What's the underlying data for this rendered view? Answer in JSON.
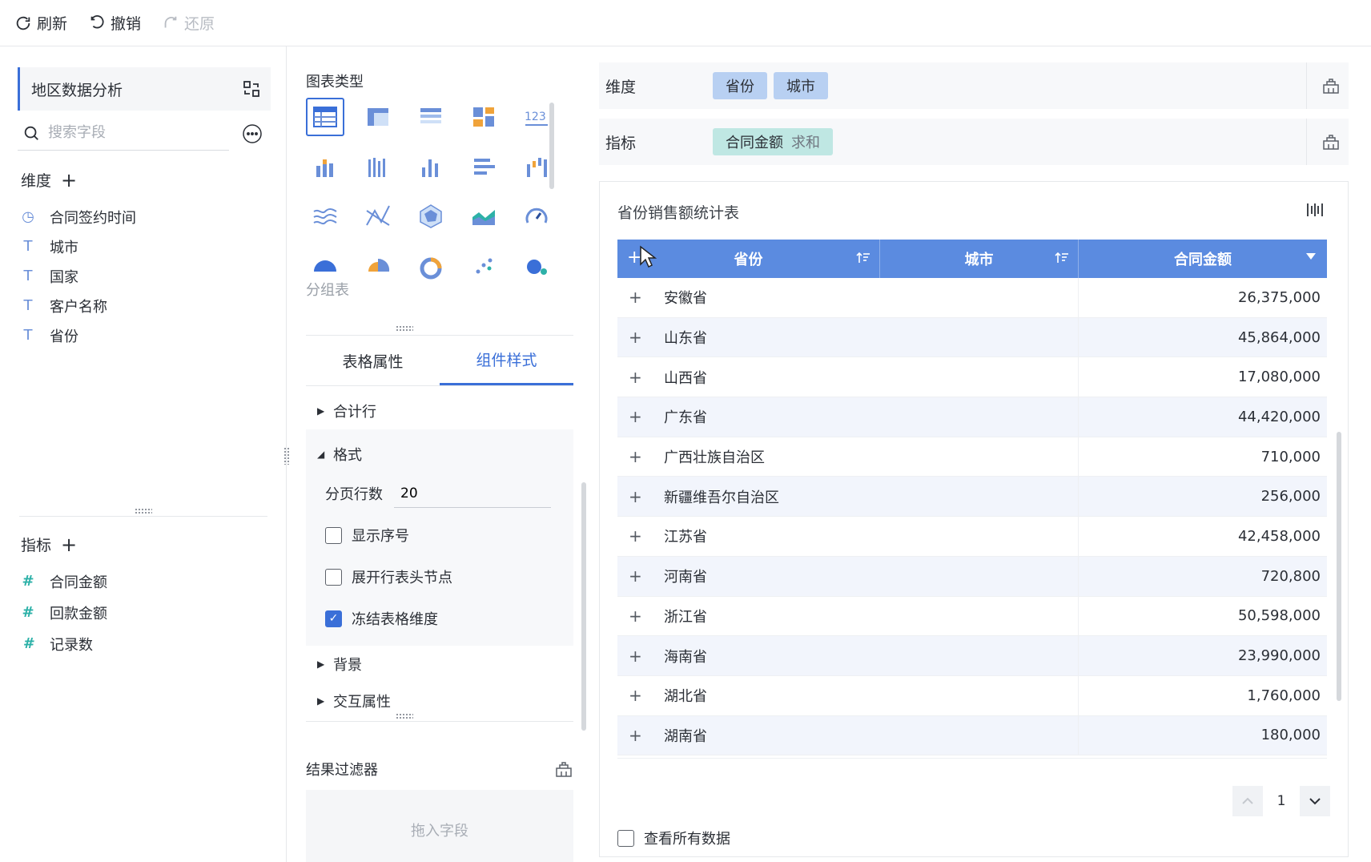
{
  "toolbar": {
    "refresh": "刷新",
    "undo": "撤销",
    "redo": "还原"
  },
  "fields_pane": {
    "dataset_name": "地区数据分析",
    "search_placeholder": "搜索字段",
    "dimension_title": "维度",
    "dimensions": [
      {
        "name": "合同签约时间",
        "icon": "clock-icon"
      },
      {
        "name": "城市",
        "icon": "text-icon"
      },
      {
        "name": "国家",
        "icon": "text-icon"
      },
      {
        "name": "客户名称",
        "icon": "text-icon"
      },
      {
        "name": "省份",
        "icon": "text-icon"
      }
    ],
    "metric_title": "指标",
    "metrics": [
      {
        "name": "合同金额",
        "icon": "number-icon"
      },
      {
        "name": "回款金额",
        "icon": "number-icon"
      },
      {
        "name": "记录数",
        "icon": "count-icon"
      }
    ]
  },
  "chart_pane": {
    "title": "图表类型",
    "hover_label": "分组表",
    "tabs": [
      "表格属性",
      "组件样式"
    ],
    "active_tab": 1,
    "sections": {
      "total_row": "合计行",
      "format": "格式",
      "page_rows_label": "分页行数",
      "page_rows_value": "20",
      "show_index": "显示序号",
      "expand_header": "展开行表头节点",
      "freeze_dims": "冻结表格维度",
      "background": "背景",
      "interaction": "交互属性"
    },
    "checks": {
      "show_index": false,
      "expand_header": false,
      "freeze_dims": true
    },
    "filter_title": "结果过滤器",
    "drop_hint": "拖入字段"
  },
  "config": {
    "dimension_label": "维度",
    "dimension_pills": [
      "省份",
      "城市"
    ],
    "metric_label": "指标",
    "metric_pill": "合同金额",
    "metric_agg": "求和"
  },
  "table": {
    "title": "省份销售额统计表",
    "headers": [
      "省份",
      "城市",
      "合同金额"
    ],
    "rows": [
      {
        "province": "安徽省",
        "amount": "26,375,000"
      },
      {
        "province": "山东省",
        "amount": "45,864,000"
      },
      {
        "province": "山西省",
        "amount": "17,080,000"
      },
      {
        "province": "广东省",
        "amount": "44,420,000"
      },
      {
        "province": "广西壮族自治区",
        "amount": "710,000"
      },
      {
        "province": "新疆维吾尔自治区",
        "amount": "256,000"
      },
      {
        "province": "江苏省",
        "amount": "42,458,000"
      },
      {
        "province": "河南省",
        "amount": "720,800"
      },
      {
        "province": "浙江省",
        "amount": "50,598,000"
      },
      {
        "province": "海南省",
        "amount": "23,990,000"
      },
      {
        "province": "湖北省",
        "amount": "1,760,000"
      },
      {
        "province": "湖南省",
        "amount": "180,000"
      }
    ],
    "page": "1",
    "see_all": "查看所有数据"
  },
  "colors": {
    "accent": "#3a6fd8",
    "header_bg": "#5b8be0",
    "dim_pill": "#b8d0f2",
    "metric_pill": "#bfe7e3"
  }
}
